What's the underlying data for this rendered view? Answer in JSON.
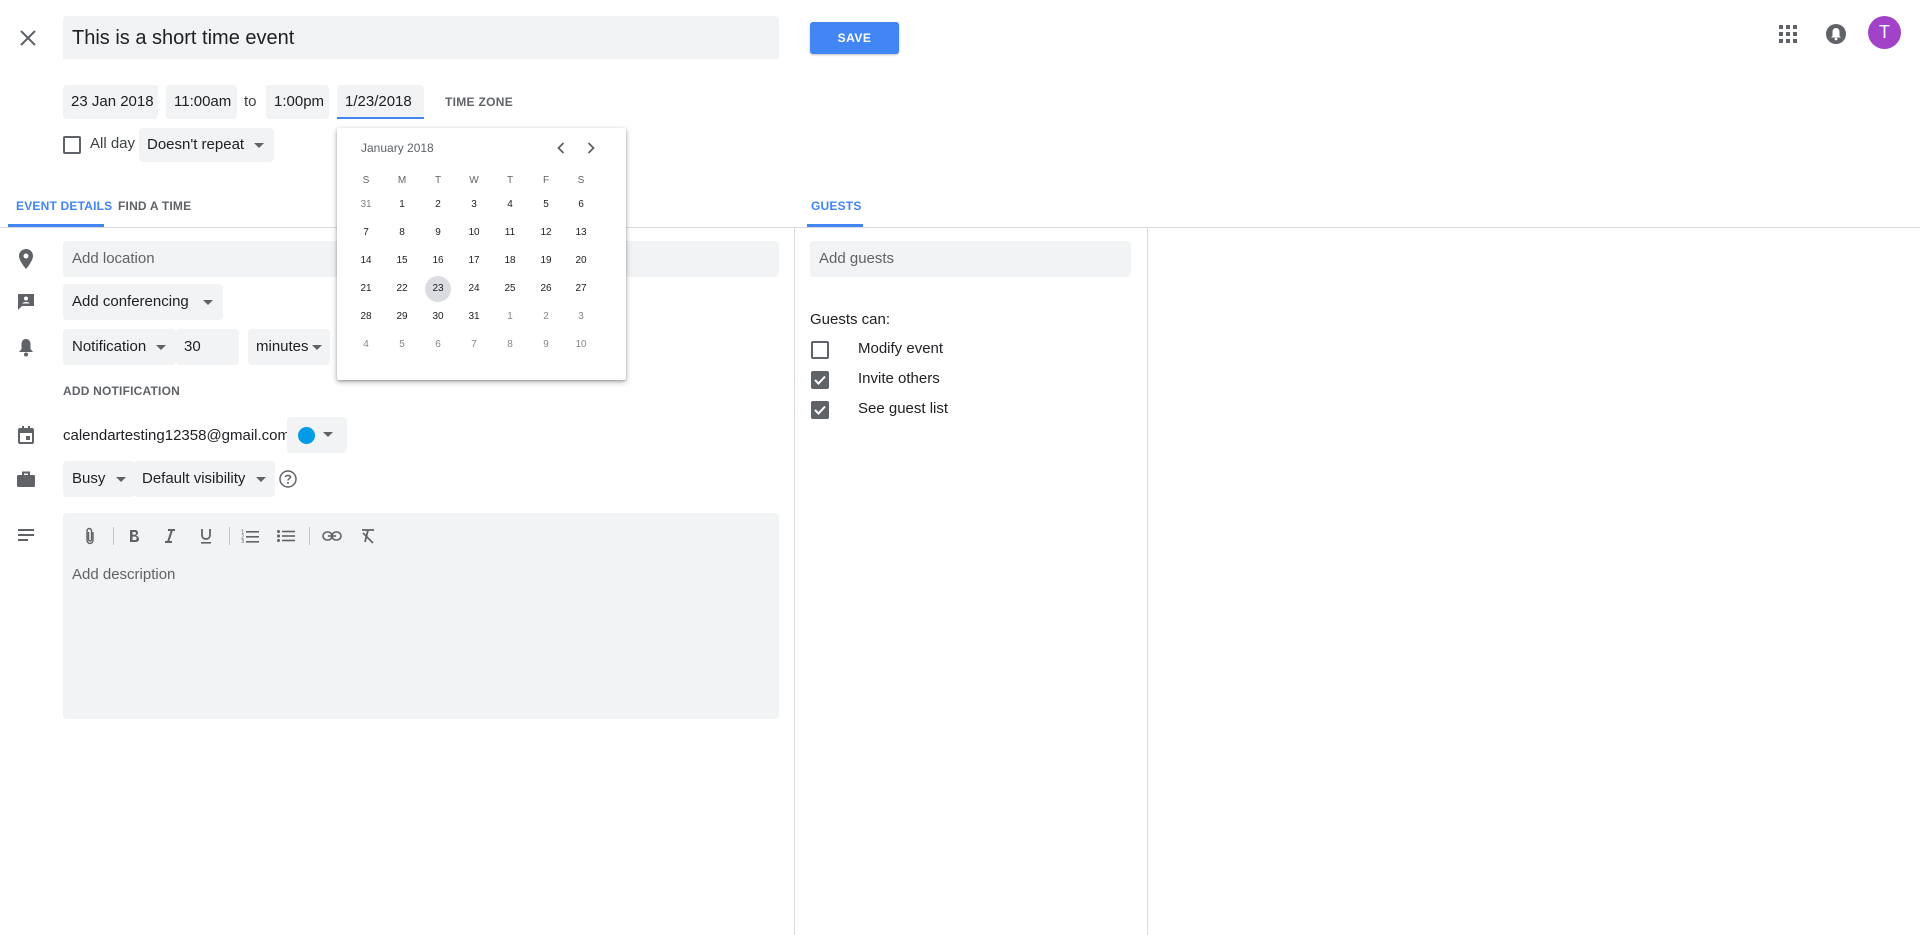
{
  "event": {
    "title": "This is a short time event",
    "save_label": "SAVE"
  },
  "header": {
    "avatar_letter": "T",
    "avatar_color": "#a142c8"
  },
  "datetime": {
    "start_date": "23 Jan 2018",
    "start_time": "11:00am",
    "to_label": "to",
    "end_time": "1:00pm",
    "end_date": "1/23/2018",
    "timezone_label": "TIME ZONE",
    "all_day_label": "All day",
    "all_day_checked": false,
    "repeat_label": "Doesn't repeat"
  },
  "tabs": {
    "event_details": "EVENT DETAILS",
    "find_a_time": "FIND A TIME",
    "guests": "GUESTS"
  },
  "details": {
    "location_placeholder": "Add location",
    "conferencing_label": "Add conferencing",
    "notification_type": "Notification",
    "notification_value": "30",
    "notification_unit": "minutes",
    "add_notification": "ADD NOTIFICATION",
    "calendar_email": "calendartesting12358@gmail.com",
    "calendar_color": "#039be5",
    "availability": "Busy",
    "visibility": "Default visibility",
    "description_placeholder": "Add description"
  },
  "guests": {
    "add_placeholder": "Add guests",
    "permissions_title": "Guests can:",
    "permissions": [
      {
        "label": "Modify event",
        "checked": false
      },
      {
        "label": "Invite others",
        "checked": true
      },
      {
        "label": "See guest list",
        "checked": true
      }
    ]
  },
  "datepicker": {
    "month_label": "January 2018",
    "weekdays": [
      "S",
      "M",
      "T",
      "W",
      "T",
      "F",
      "S"
    ],
    "selected_day": "23",
    "weeks": [
      [
        {
          "d": "31",
          "o": true
        },
        {
          "d": "1"
        },
        {
          "d": "2"
        },
        {
          "d": "3"
        },
        {
          "d": "4"
        },
        {
          "d": "5"
        },
        {
          "d": "6"
        }
      ],
      [
        {
          "d": "7"
        },
        {
          "d": "8"
        },
        {
          "d": "9"
        },
        {
          "d": "10"
        },
        {
          "d": "11"
        },
        {
          "d": "12"
        },
        {
          "d": "13"
        }
      ],
      [
        {
          "d": "14"
        },
        {
          "d": "15"
        },
        {
          "d": "16"
        },
        {
          "d": "17"
        },
        {
          "d": "18"
        },
        {
          "d": "19"
        },
        {
          "d": "20"
        }
      ],
      [
        {
          "d": "21"
        },
        {
          "d": "22"
        },
        {
          "d": "23",
          "sel": true
        },
        {
          "d": "24"
        },
        {
          "d": "25"
        },
        {
          "d": "26"
        },
        {
          "d": "27"
        }
      ],
      [
        {
          "d": "28"
        },
        {
          "d": "29"
        },
        {
          "d": "30"
        },
        {
          "d": "31"
        },
        {
          "d": "1",
          "o": true
        },
        {
          "d": "2",
          "o": true
        },
        {
          "d": "3",
          "o": true
        }
      ],
      [
        {
          "d": "4",
          "o": true
        },
        {
          "d": "5",
          "o": true
        },
        {
          "d": "6",
          "o": true
        },
        {
          "d": "7",
          "o": true
        },
        {
          "d": "8",
          "o": true
        },
        {
          "d": "9",
          "o": true
        },
        {
          "d": "10",
          "o": true
        }
      ]
    ]
  }
}
